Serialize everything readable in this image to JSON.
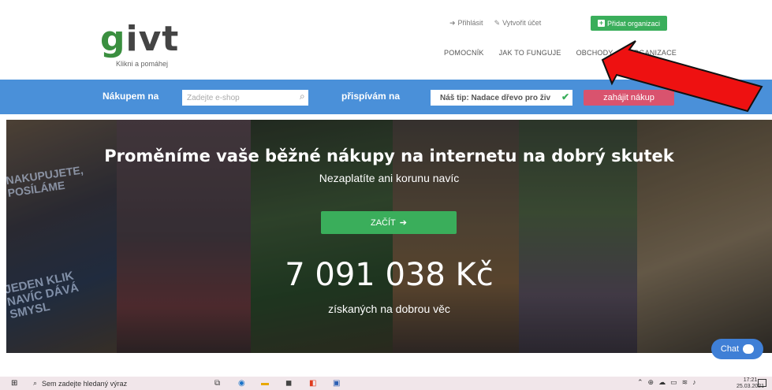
{
  "header": {
    "logo_text": "givt",
    "logo_tagline": "Klikni a pomáhej",
    "top_links": {
      "login": "Přihlásit",
      "create_account": "Vytvořit účet",
      "add_org": "Přidat organizaci"
    },
    "nav": [
      "POMOCNÍK",
      "JAK TO FUNGUJE",
      "OBCHODY",
      "ORGANIZACE"
    ]
  },
  "search_bar": {
    "buy_label": "Nákupem na",
    "shop_placeholder": "Zadejte e-shop",
    "give_label": "přispívám na",
    "tip_value": "Náš tip: Nadace dřevo pro živ",
    "start_button": "zahájit nákup"
  },
  "hero": {
    "title": "Proměníme vaše běžné nákupy na internetu na dobrý skutek",
    "subtitle": "Nezaplatíte ani korunu navíc",
    "start_button": "ZAČÍT",
    "counter": "7 091 038 Kč",
    "counter_label": "získaných na dobrou věc",
    "side_text_top": "NAKUPUJETE, POSÍLÁME",
    "side_text_bottom": "JEDEN KLIK NAVÍC DÁVÁ SMYSL"
  },
  "chat": {
    "label": "Chat"
  },
  "taskbar": {
    "search_placeholder": "Sem zadejte hledaný výraz",
    "time": "17:21",
    "date": "25.03.2021"
  },
  "colors": {
    "green": "#3aae5b",
    "blue_bar": "#4a90d9",
    "pink_button": "#d9536e",
    "arrow_red": "#ee1111"
  }
}
